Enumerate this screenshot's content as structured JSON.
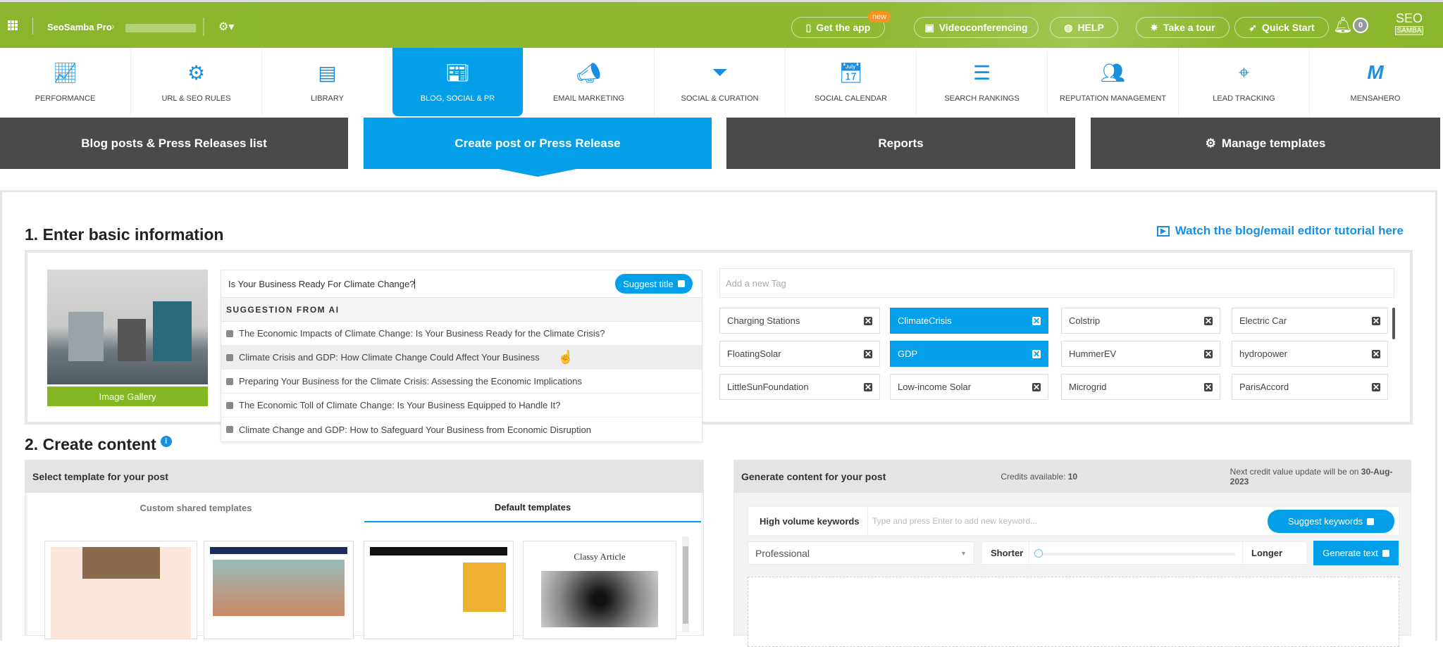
{
  "topbar": {
    "app_name": "SeoSamba Pro",
    "buttons": [
      {
        "label": "Get the app",
        "icon": "mobile-icon"
      },
      {
        "label": "Videoconferencing",
        "icon": "video-chat-icon"
      },
      {
        "label": "HELP",
        "icon": "globe-icon"
      },
      {
        "label": "Take a tour",
        "icon": "lightbulb-icon"
      },
      {
        "label": "Quick Start",
        "icon": "rocket-icon"
      }
    ],
    "new_badge": "new",
    "notifications": "0",
    "logo_top": "SEO",
    "logo_bottom": "SAMBA",
    "color": "#8ab52d"
  },
  "nav": [
    {
      "label": "Performance",
      "icon": "chart-icon"
    },
    {
      "label": "URL & SEO Rules",
      "icon": "gear-link-icon"
    },
    {
      "label": "Library",
      "icon": "library-icon"
    },
    {
      "label": "Blog, Social & PR",
      "icon": "newspaper-icon",
      "active": true
    },
    {
      "label": "Email Marketing",
      "icon": "megaphone-icon"
    },
    {
      "label": "Social & Curation",
      "icon": "funnel-icon"
    },
    {
      "label": "Social Calendar",
      "icon": "calendar-icon"
    },
    {
      "label": "Search Rankings",
      "icon": "google-rank-icon"
    },
    {
      "label": "Reputation Management",
      "icon": "people-icon"
    },
    {
      "label": "Lead Tracking",
      "icon": "target-icon"
    },
    {
      "label": "MensaHero",
      "icon": "mensahero-icon"
    }
  ],
  "subtabs": [
    "Blog posts & Press Releases list",
    "Create post or Press Release",
    "Reports",
    "Manage templates"
  ],
  "section1": {
    "heading": "1. Enter basic information",
    "tutorial_link": "Watch the blog/email editor tutorial here",
    "image_gallery": "Image Gallery",
    "title_value": "Is Your Business Ready For Climate Change?",
    "suggest_title": "Suggest title",
    "suggestion_header": "SUGGESTION FROM AI",
    "suggestions": [
      "The Economic Impacts of Climate Change: Is Your Business Ready for the Climate Crisis?",
      "Climate Crisis and GDP: How Climate Change Could Affect Your Business",
      "Preparing Your Business for the Climate Crisis: Assessing the Economic Implications",
      "The Economic Toll of Climate Change: Is Your Business Equipped to Handle It?",
      "Climate Change and GDP: How to Safeguard Your Business from Economic Disruption"
    ],
    "tag_placeholder": "Add a new Tag",
    "tags": [
      {
        "label": "Charging Stations"
      },
      {
        "label": "ClimateCrisis",
        "selected": true
      },
      {
        "label": "Colstrip"
      },
      {
        "label": "Electric Car"
      },
      {
        "label": "FloatingSolar"
      },
      {
        "label": "GDP",
        "selected": true
      },
      {
        "label": "HummerEV"
      },
      {
        "label": "hydropower"
      },
      {
        "label": "LittleSunFoundation"
      },
      {
        "label": "Low-income Solar"
      },
      {
        "label": "Microgrid"
      },
      {
        "label": "ParisAccord"
      }
    ]
  },
  "section2": {
    "heading": "2. Create content",
    "template_panel": {
      "title": "Select template for your post",
      "tabs": [
        "Custom shared templates",
        "Default templates"
      ],
      "active_tab": 1,
      "thumb4_title": "Classy Article"
    },
    "generate_panel": {
      "title": "Generate content for your post",
      "credits_label": "Credits available: ",
      "credits": "10",
      "update_label": "Next credit value update will be on ",
      "update_date": "30-Aug-2023",
      "keywords_label": "High volume keywords",
      "keywords_placeholder": "Type and press Enter to add new keyword...",
      "suggest_keywords": "Suggest keywords",
      "tone": "Professional",
      "shorter": "Shorter",
      "longer": "Longer",
      "length_value": 0,
      "generate_text": "Generate text"
    }
  },
  "accent": "#03a0e9"
}
